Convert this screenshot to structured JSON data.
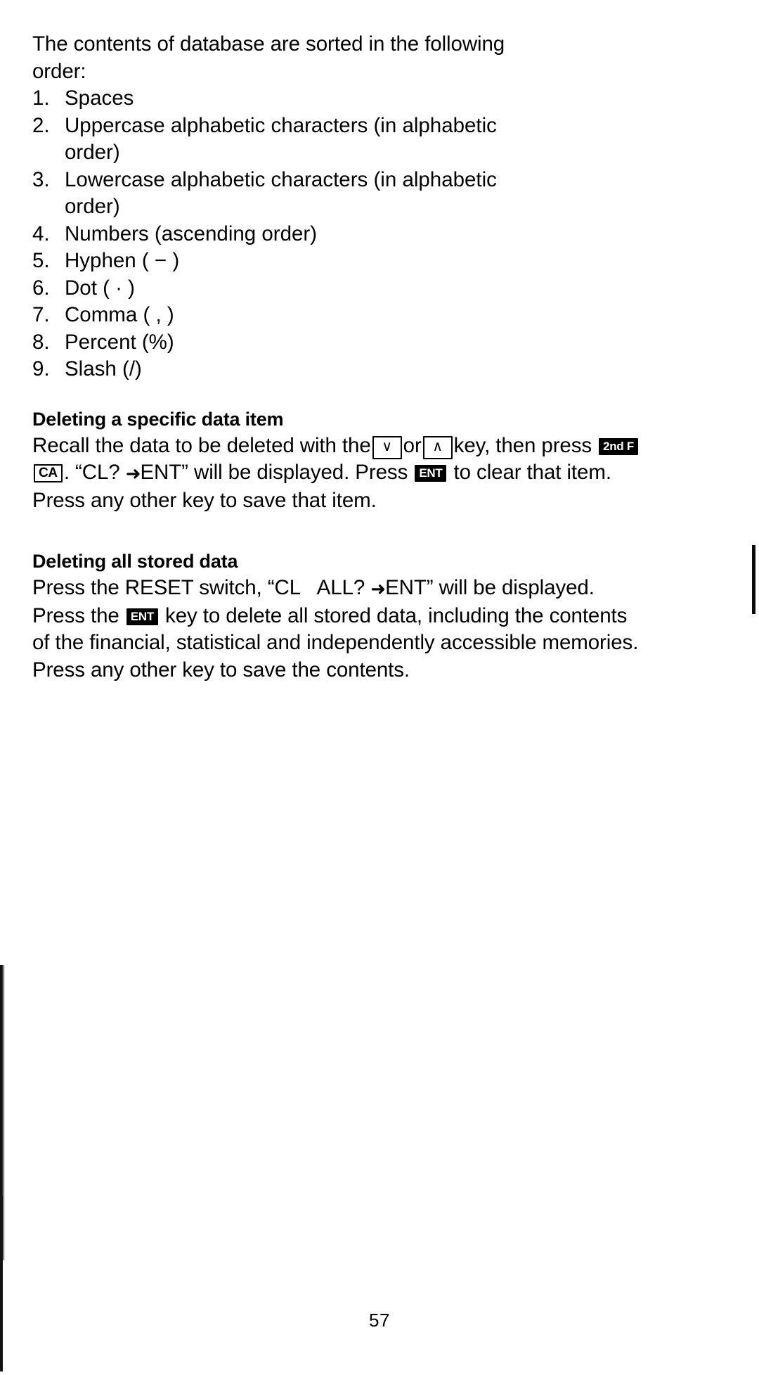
{
  "page": {
    "number": "57"
  },
  "intro": {
    "text": "The contents of database are sorted in the following order:"
  },
  "sort_list": [
    {
      "num": "1.",
      "text": "Spaces"
    },
    {
      "num": "2.",
      "text": "Uppercase alphabetic characters (in alphabetic order)"
    },
    {
      "num": "3.",
      "text": "Lowercase alphabetic characters (in alphabetic order)"
    },
    {
      "num": "4.",
      "text": "Numbers (ascending order)"
    },
    {
      "num": "5.",
      "text": "Hyphen ( − )"
    },
    {
      "num": "6.",
      "text": "Dot ( · )"
    },
    {
      "num": "7.",
      "text": "Comma ( , )"
    },
    {
      "num": "8.",
      "text": "Percent (%)"
    },
    {
      "num": "9.",
      "text": "Slash (/)"
    }
  ],
  "section_delete_item": {
    "heading": "Deleting a specific data item",
    "text_1": "Recall the data to be deleted with the",
    "key_down": "∨",
    "text_2": "or",
    "key_up": "∧",
    "text_3": "key, then press",
    "key_2ndf": "2nd F",
    "key_ca": "CA",
    "text_4": ". “CL?",
    "arrow": "➜",
    "text_5": "ENT” will be displayed. Press",
    "key_ent": "ENT",
    "text_6": "to clear that item. Press any other key to save that item."
  },
  "section_delete_all": {
    "heading": "Deleting all stored data",
    "text_1": "Press the RESET switch, “CL   ALL?",
    "arrow": "➜",
    "text_2": "ENT” will be displayed. Press the",
    "key_ent": "ENT",
    "text_3": "key to delete all stored data, including the contents of the financial, statistical and independently accessible memories. Press any other key to save the contents."
  }
}
